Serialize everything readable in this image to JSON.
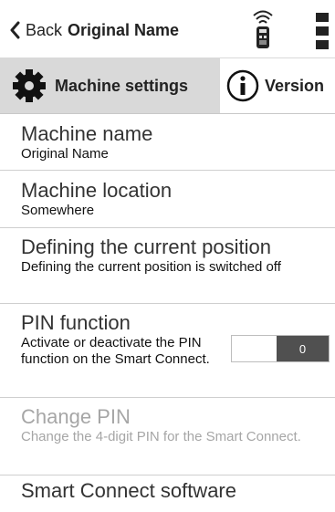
{
  "header": {
    "back_label": "Back",
    "title": "Original Name",
    "icons": [
      "remote-control-icon",
      "kebab-menu-icon"
    ]
  },
  "tabs": [
    {
      "label": "Machine settings",
      "icon": "gear-icon",
      "active": true
    },
    {
      "label": "Version",
      "icon": "info-icon",
      "active": false
    }
  ],
  "settings": {
    "machine_name": {
      "title": "Machine name",
      "value": "Original Name"
    },
    "machine_location": {
      "title": "Machine location",
      "value": "Somewhere"
    },
    "current_position": {
      "title": "Defining the current position",
      "description": "Defining the current position is switched off"
    },
    "pin_function": {
      "title": "PIN function",
      "description": "Activate or deactivate the PIN function on the Smart Connect.",
      "toggle_label": "0",
      "enabled": false
    },
    "change_pin": {
      "title": "Change PIN",
      "description": "Change the 4-digit PIN for the Smart Connect.",
      "disabled": true
    },
    "software": {
      "title": "Smart Connect software"
    }
  },
  "colors": {
    "active_tab_bg": "#d9d9d9",
    "toggle_knob": "#505050",
    "disabled_text": "#a6a6a6"
  }
}
